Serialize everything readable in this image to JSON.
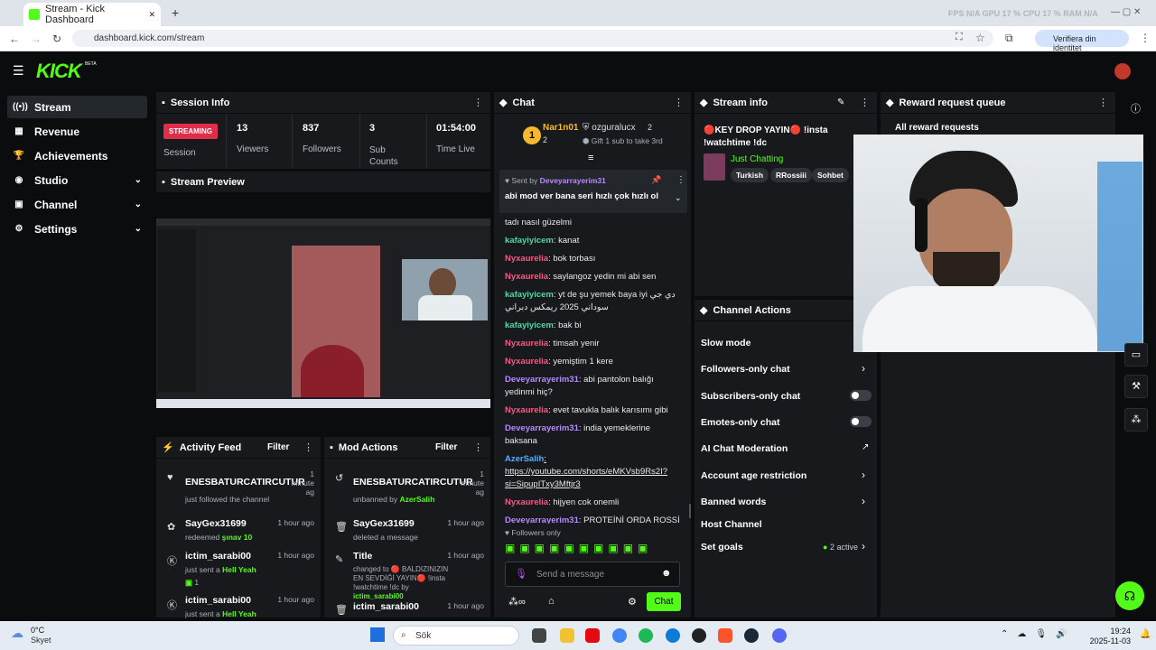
{
  "browser": {
    "tab_title": "Stream - Kick Dashboard",
    "new_tab": "+",
    "close_tab": "✕",
    "url": "dashboard.kick.com/stream",
    "profile": "Verifiera din identitet",
    "stats": "FPS N/A   GPU 17 %   CPU 17 %   RAM N/A"
  },
  "header": {
    "logo": "KICK",
    "beta": "BETA"
  },
  "sidebar": {
    "items": [
      {
        "label": "Stream",
        "icon": "((•))"
      },
      {
        "label": "Revenue",
        "icon": "▦"
      },
      {
        "label": "Achievements",
        "icon": "🏆"
      },
      {
        "label": "Studio",
        "icon": "◉"
      },
      {
        "label": "Channel",
        "icon": "▣"
      },
      {
        "label": "Settings",
        "icon": "⚙"
      }
    ]
  },
  "session": {
    "title": "Session Info",
    "badge": "STREAMING",
    "badge_label": "Session",
    "viewers_value": "13",
    "viewers_label": "Viewers",
    "followers_value": "837",
    "followers_label": "Followers",
    "subs_value": "3",
    "subs_label": "Sub\nCounts",
    "time_value": "01:54:00",
    "time_label": "Time Live"
  },
  "preview": {
    "title": "Stream Preview"
  },
  "activity": {
    "title": "Activity Feed",
    "filter": "Filter",
    "items": [
      {
        "name": "ENESBATURCATIRCUTUR",
        "time": "1\nminute\nag",
        "desc": "just followed the channel",
        "extra": ""
      },
      {
        "name": "SayGex31699",
        "time": "1 hour ago",
        "desc": "redeemed ",
        "extra": "şınav 10"
      },
      {
        "name": "ictim_sarabi00",
        "time": "1 hour ago",
        "desc": "just sent a ",
        "extra": "Hell Yeah",
        "count": "1"
      },
      {
        "name": "ictim_sarabi00",
        "time": "1 hour ago",
        "desc": "just sent a ",
        "extra": "Hell Yeah"
      }
    ]
  },
  "mod": {
    "title": "Mod Actions",
    "filter": "Filter",
    "items": [
      {
        "name": "ENESBATURCATIRCUTUR",
        "time": "1\nminute\nag",
        "desc": "unbanned by ",
        "extra": "AzerSalih"
      },
      {
        "name": "SayGex31699",
        "time": "1 hour ago",
        "desc": "deleted a message",
        "extra": ""
      },
      {
        "name": "Title",
        "time": "1 hour ago",
        "desc": "changed to 🔴 BALDIZINIZIN EN SEVDİĞİ YAYIN🔴 !insta !watchtime !dc by ",
        "extra": "ictim_sarabi00"
      },
      {
        "name": "ictim_sarabi00",
        "time": "1 hour ago",
        "desc": "",
        "extra": ""
      }
    ]
  },
  "chat": {
    "title": "Chat",
    "top1_name": "Nar1n01",
    "top1_rank": "1",
    "top1_count": "2",
    "top2_name": "ozguralucx",
    "top2_count": "2",
    "top2_sub": "Gift 1 sub to take 3rd",
    "pinned_by_label": "Sent by ",
    "pinned_by": "Deveyarrayerim31",
    "pinned_text": "abi mod ver bana seri hızlı çok hızlı ol",
    "messages": [
      {
        "user": "",
        "text": "tadı nasıl güzelmi",
        "color": ""
      },
      {
        "user": "kafayiyicem",
        "text": ": kanat",
        "color": "ugreen"
      },
      {
        "user": "Nyxaurelia",
        "text": ": bok torbası",
        "color": "upink"
      },
      {
        "user": "Nyxaurelia",
        "text": ": saylangoz yedin mi abi sen",
        "color": "upink"
      },
      {
        "user": "kafayiyicem",
        "text": ": yt de şu yemek baya iyi دي جي سوداني 2025 ريمكس دبراني",
        "color": "ugreen"
      },
      {
        "user": "kafayiyicem",
        "text": ": bak bi",
        "color": "ugreen"
      },
      {
        "user": "Nyxaurelia",
        "text": ": timsah yenir",
        "color": "upink"
      },
      {
        "user": "Nyxaurelia",
        "text": ": yemiştim 1 kere",
        "color": "upink"
      },
      {
        "user": "Deveyarrayerim31",
        "text": ": abi pantolon balığı yedinmi hiç?",
        "color": "upurple"
      },
      {
        "user": "Nyxaurelia",
        "text": ": evet tavukla balık karısımı gibi",
        "color": "upink"
      },
      {
        "user": "Deveyarrayerim31",
        "text": ": india yemeklerine baksana",
        "color": "upurple"
      },
      {
        "user": "AzerSalih",
        "text": ":\nhttps://youtube.com/shorts/eMKVsb9Rs2I?si=SipupITxy3Mftjr3",
        "color": "ublue"
      },
      {
        "user": "Nyxaurelia",
        "text": ": hijyen cok onemli",
        "color": "upink"
      },
      {
        "user": "Deveyarrayerim31",
        "text": ": PROTEİNİ ORDA ROSSİ",
        "color": "upurple"
      }
    ],
    "followers_only": "Followers only",
    "input_placeholder": "Send a message",
    "send": "Chat"
  },
  "streaminfo": {
    "title": "Stream info",
    "stream_title": "🔴KEY DROP YAYIN🔴 !insta !watchtime !dc",
    "category": "Just Chatting",
    "tags": [
      "Turkish",
      "RRossiii",
      "Sohbet"
    ]
  },
  "reward": {
    "title": "Reward request queue",
    "all": "All reward requests"
  },
  "actions": {
    "title": "Channel Actions",
    "slow": "Slow mode",
    "followers_only": "Followers-only chat",
    "subs_only": "Subscribers-only chat",
    "emotes_only": "Emotes-only chat",
    "ai_mod": "AI Chat Moderation",
    "account_age": "Account age restriction",
    "banned": "Banned words",
    "host": "Host Channel",
    "goals": "Set goals",
    "goals_active": "2 active"
  },
  "taskbar": {
    "weather_temp": "0°C",
    "weather_desc": "Skyet",
    "search": "Sök",
    "time": "19:24",
    "date": "2025-11-03"
  },
  "colors": {
    "accent": "#53fc18",
    "streaming": "#e02d4a",
    "panel": "#17191c"
  }
}
